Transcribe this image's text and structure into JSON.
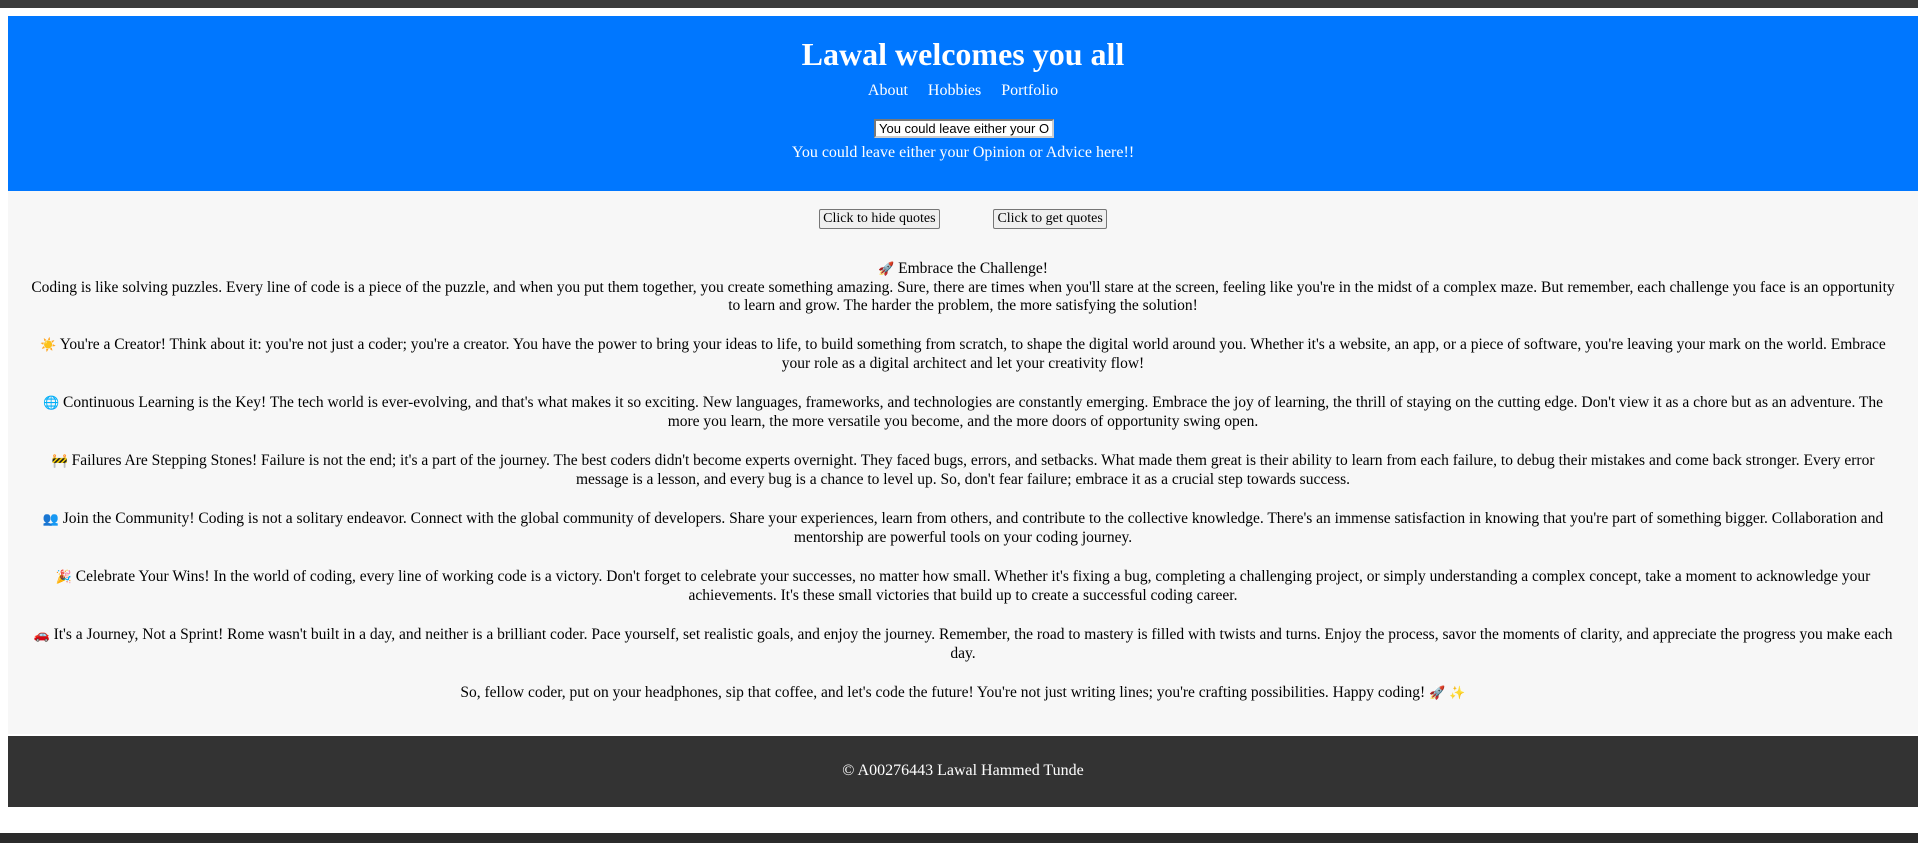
{
  "header": {
    "title": "Lawal welcomes you all",
    "nav": [
      "About",
      "Hobbies",
      "Portfolio"
    ],
    "input_value": "You could leave either your Opinion or Advice here!!",
    "prompt": "You could leave either your Opinion or Advice here!!"
  },
  "buttons": {
    "hide_quotes": "Click to hide quotes",
    "get_quotes": "Click to get quotes"
  },
  "quotes": [
    {
      "icon": "🚀",
      "title": "Embrace the Challenge!",
      "text": "Coding is like solving puzzles. Every line of code is a piece of the puzzle, and when you put them together, you create something amazing. Sure, there are times when you'll stare at the screen, feeling like you're in the midst of a complex maze. But remember, each challenge you face is an opportunity to learn and grow. The harder the problem, the more satisfying the solution!"
    },
    {
      "icon": "☀️",
      "text": "You're a Creator! Think about it: you're not just a coder; you're a creator. You have the power to bring your ideas to life, to build something from scratch, to shape the digital world around you. Whether it's a website, an app, or a piece of software, you're leaving your mark on the world. Embrace your role as a digital architect and let your creativity flow!"
    },
    {
      "icon": "🌐",
      "text": "Continuous Learning is the Key! The tech world is ever-evolving, and that's what makes it so exciting. New languages, frameworks, and technologies are constantly emerging. Embrace the joy of learning, the thrill of staying on the cutting edge. Don't view it as a chore but as an adventure. The more you learn, the more versatile you become, and the more doors of opportunity swing open."
    },
    {
      "icon": "🚧",
      "text": "Failures Are Stepping Stones! Failure is not the end; it's a part of the journey. The best coders didn't become experts overnight. They faced bugs, errors, and setbacks. What made them great is their ability to learn from each failure, to debug their mistakes and come back stronger. Every error message is a lesson, and every bug is a chance to level up. So, don't fear failure; embrace it as a crucial step towards success."
    },
    {
      "icon": "👥",
      "text": "Join the Community! Coding is not a solitary endeavor. Connect with the global community of developers. Share your experiences, learn from others, and contribute to the collective knowledge. There's an immense satisfaction in knowing that you're part of something bigger. Collaboration and mentorship are powerful tools on your coding journey."
    },
    {
      "icon": "🎉",
      "text": "Celebrate Your Wins! In the world of coding, every line of working code is a victory. Don't forget to celebrate your successes, no matter how small. Whether it's fixing a bug, completing a challenging project, or simply understanding a complex concept, take a moment to acknowledge your achievements. It's these small victories that build up to create a successful coding career."
    },
    {
      "icon": "🚗",
      "text": "It's a Journey, Not a Sprint! Rome wasn't built in a day, and neither is a brilliant coder. Pace yourself, set realistic goals, and enjoy the journey. Remember, the road to mastery is filled with twists and turns. Enjoy the process, savor the moments of clarity, and appreciate the progress you make each day."
    }
  ],
  "closing": {
    "text": "So, fellow coder, put on your headphones, sip that coffee, and let's code the future! You're not just writing lines; you're crafting possibilities. Happy coding!",
    "icons": "🚀 ✨"
  },
  "footer": {
    "text": "© A00276443 Lawal Hammed Tunde"
  },
  "colors": {
    "header_bg": "#0077ff",
    "content_bg": "#f7f7f7",
    "footer_bg": "#333333"
  }
}
